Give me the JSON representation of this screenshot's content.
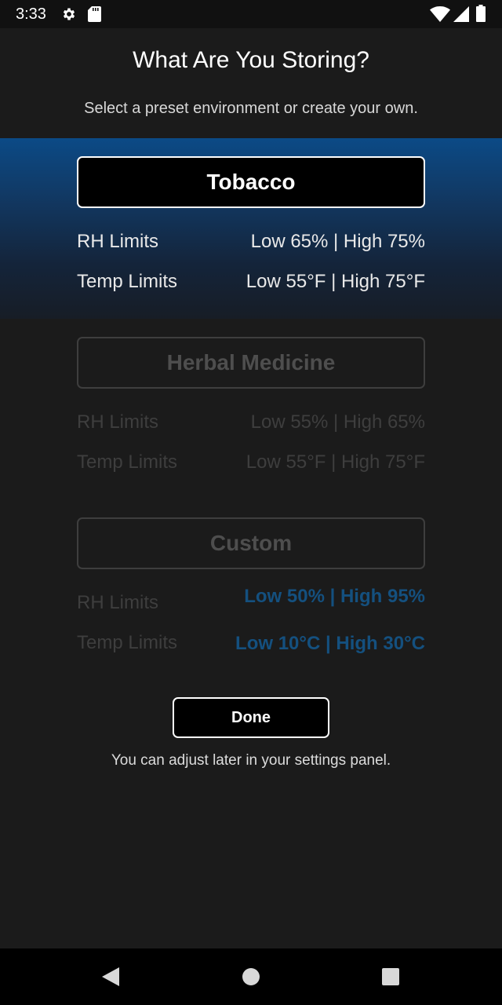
{
  "status_bar": {
    "time": "3:33",
    "icons": [
      "gear-icon",
      "sd-card-icon",
      "wifi-icon",
      "signal-icon",
      "battery-icon"
    ]
  },
  "header": {
    "title": "What Are You Storing?",
    "subtitle": "Select a preset environment or create your own."
  },
  "presets": [
    {
      "name": "Tobacco",
      "selected": true,
      "rh_label": "RH Limits",
      "rh_value": "Low 65% | High 75%",
      "temp_label": "Temp Limits",
      "temp_value": "Low 55°F | High 75°F"
    },
    {
      "name": "Herbal Medicine",
      "selected": false,
      "rh_label": "RH Limits",
      "rh_value": "Low 55% | High 65%",
      "temp_label": "Temp Limits",
      "temp_value": "Low 55°F | High 75°F"
    },
    {
      "name": "Custom",
      "selected": false,
      "rh_label": "RH Limits",
      "rh_value": "Low 50% | High 95%",
      "temp_label": "Temp Limits",
      "temp_value": "Low 10°C | High 30°C"
    }
  ],
  "actions": {
    "done_label": "Done",
    "footnote": "You can adjust later in your settings panel."
  },
  "colors": {
    "accent_blue": "#0b4a86",
    "custom_value_blue": "#14507f",
    "background": "#1b1b1b"
  },
  "nav_bar": {
    "icons": [
      "back-icon",
      "home-icon",
      "recent-apps-icon"
    ]
  }
}
